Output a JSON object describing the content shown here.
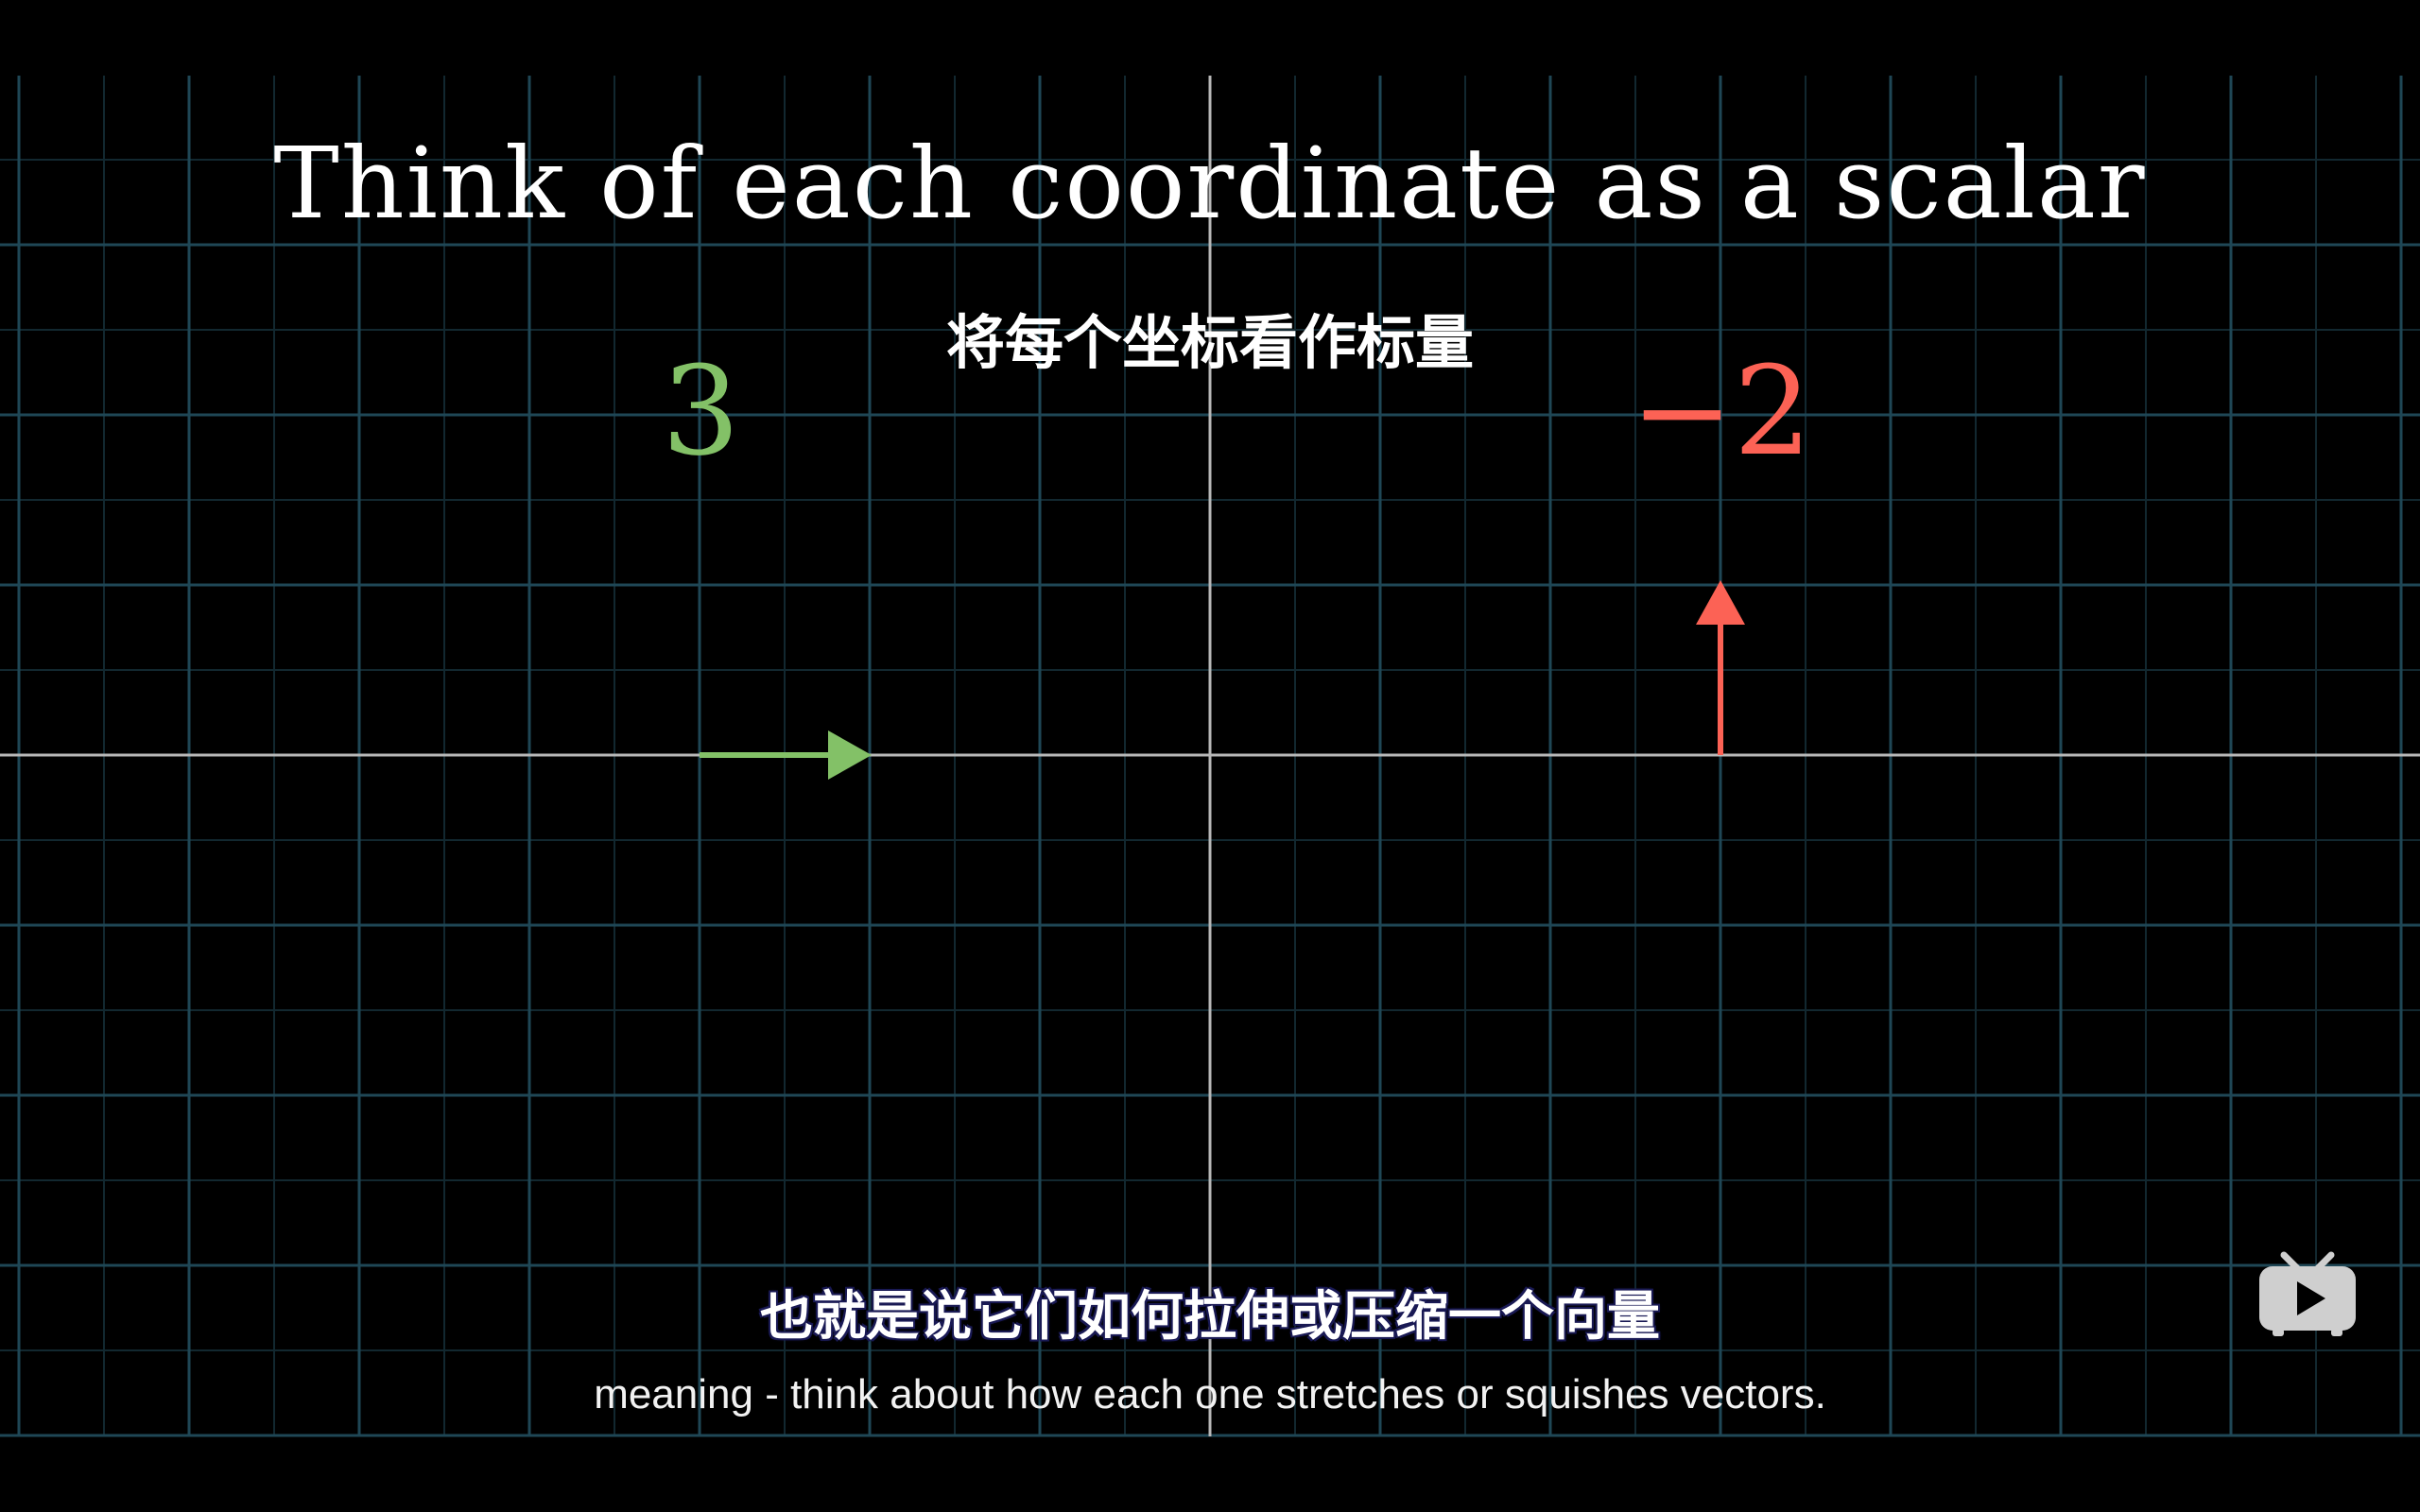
{
  "video": {
    "title": "Think of each coordinate as a scalar",
    "title_cn": "将每个坐标看作标量",
    "scalar_x": "3",
    "scalar_y": "−2",
    "caption_cn": "也就是说它们如何拉伸或压缩一个向量",
    "caption_en": "meaning - think about how each one stretches or squishes vectors."
  },
  "colors": {
    "background": "#000000",
    "grid_major": "#1f4756",
    "grid_minor": "#122830",
    "axis": "#b8b8b8",
    "vector_x": "#83c167",
    "vector_y": "#fc6255"
  },
  "icons": {
    "logo": "bilibili-tv-icon"
  }
}
